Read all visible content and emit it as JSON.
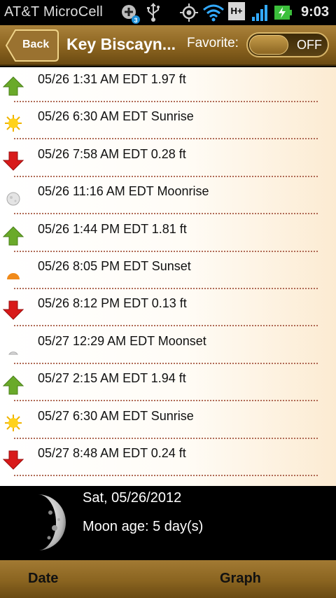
{
  "status_bar": {
    "carrier": "AT&T MicroCell",
    "notification_count": "3",
    "network_type": "H+",
    "time": "9:03"
  },
  "header": {
    "back_label": "Back",
    "title": "Key Biscayn...",
    "favorite_label": "Favorite:",
    "favorite_toggle": "OFF"
  },
  "events": [
    {
      "text": "05/26 1:31 AM EDT 1.97 ft",
      "icon": "high-tide-icon"
    },
    {
      "text": "05/26 6:30 AM EDT Sunrise",
      "icon": "sunrise-icon"
    },
    {
      "text": "05/26 7:58 AM EDT 0.28 ft",
      "icon": "low-tide-icon"
    },
    {
      "text": "05/26 11:16 AM EDT Moonrise",
      "icon": "moonrise-icon"
    },
    {
      "text": "05/26 1:44 PM EDT 1.81 ft",
      "icon": "high-tide-icon"
    },
    {
      "text": "05/26 8:05 PM EDT Sunset",
      "icon": "sunset-icon"
    },
    {
      "text": "05/26 8:12 PM EDT 0.13 ft",
      "icon": "low-tide-icon"
    },
    {
      "text": "05/27 12:29 AM EDT Moonset",
      "icon": "moonset-icon"
    },
    {
      "text": "05/27 2:15 AM EDT 1.94 ft",
      "icon": "high-tide-icon"
    },
    {
      "text": "05/27 6:30 AM EDT Sunrise",
      "icon": "sunrise-icon"
    },
    {
      "text": "05/27 8:48 AM EDT 0.24 ft",
      "icon": "low-tide-icon"
    }
  ],
  "moon": {
    "date": "Sat, 05/26/2012",
    "age": "Moon age: 5 day(s)"
  },
  "bottom_tabs": {
    "date": "Date",
    "graph": "Graph"
  },
  "colors": {
    "high_tide_arrow": "#6aaa2a",
    "low_tide_arrow": "#d81a1a",
    "separator": "#b06a55",
    "header_gold": "#8b6420"
  }
}
